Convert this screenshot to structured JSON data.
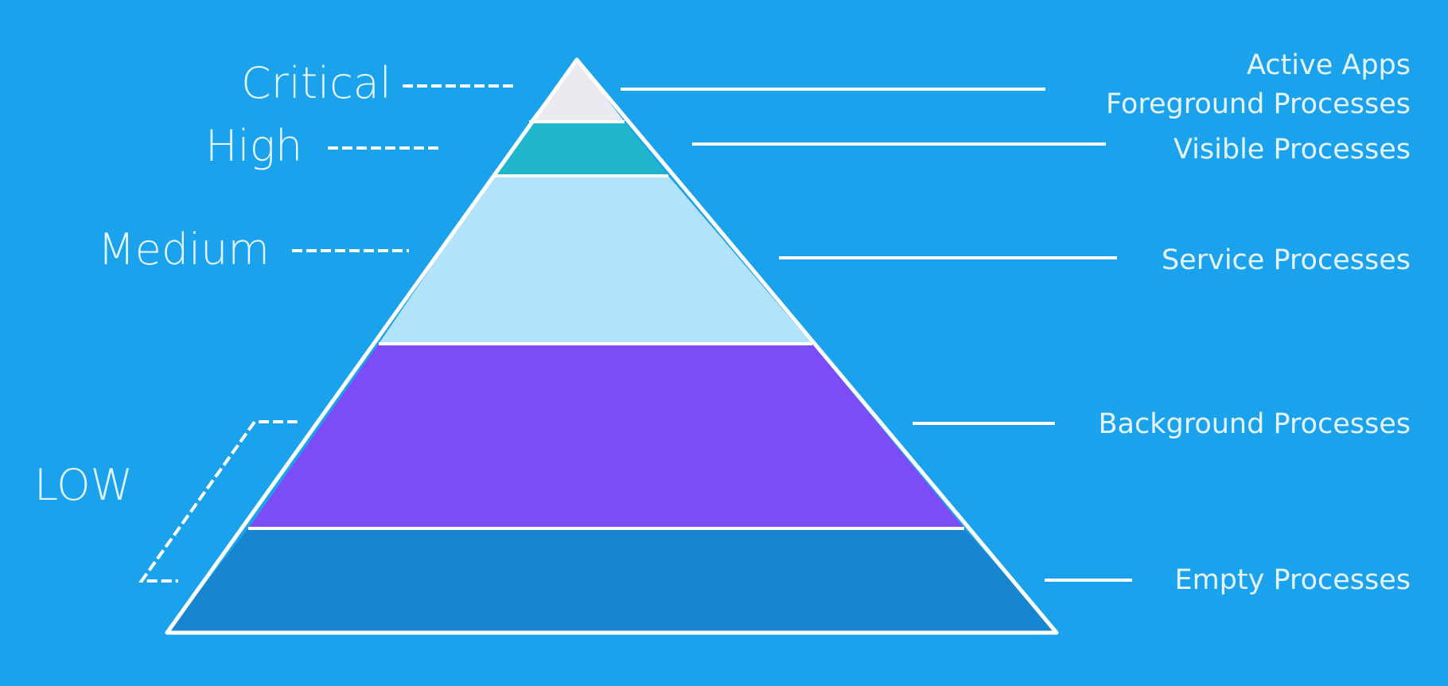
{
  "colors": {
    "background": "#1aa3ec",
    "tier_critical": "#ece9f1",
    "tier_high": "#1fb5cc",
    "tier_medium": "#b3e3fa",
    "tier_background": "#7c4df6",
    "tier_empty": "#1785cf"
  },
  "levels": {
    "critical": "Critical",
    "high": "High",
    "medium": "Medium",
    "low": "LOW"
  },
  "processes": {
    "active_apps": "Active Apps",
    "foreground": "Foreground Processes",
    "visible": "Visible Processes",
    "service": "Service Processes",
    "background": "Background Processes",
    "empty": "Empty Processes"
  }
}
